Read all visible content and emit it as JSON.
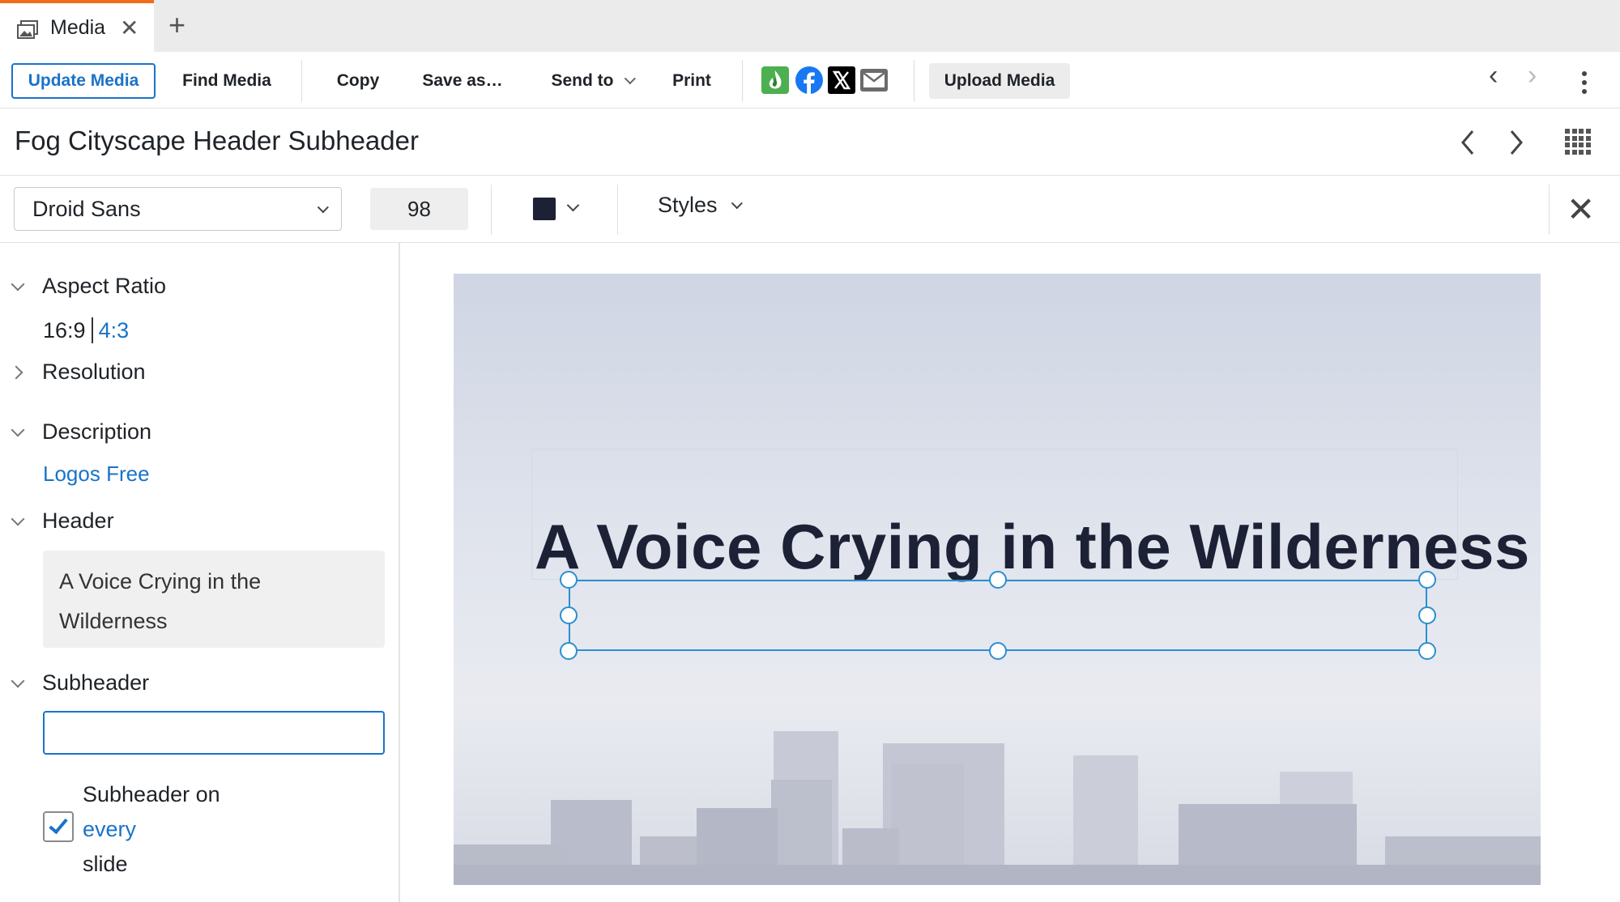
{
  "tab": {
    "label": "Media",
    "icon": "media-gallery-icon",
    "accent": "#f26b1d"
  },
  "toolbar": {
    "update_media": "Update Media",
    "find_media": "Find Media",
    "copy": "Copy",
    "save_as": "Save as…",
    "send_to": "Send to",
    "print": "Print",
    "upload_media": "Upload Media",
    "share_icons": [
      "logos-flame-icon",
      "facebook-icon",
      "x-twitter-icon",
      "email-icon"
    ]
  },
  "title": "Fog Cityscape Header Subheader",
  "format": {
    "font": "Droid Sans",
    "size": "98",
    "text_color": "#1c2136",
    "styles": "Styles"
  },
  "panel": {
    "aspect_ratio": {
      "label": "Aspect Ratio",
      "active": "16:9",
      "option": "4:3"
    },
    "resolution": {
      "label": "Resolution"
    },
    "description": {
      "label": "Description",
      "link": "Logos Free"
    },
    "header": {
      "label": "Header",
      "value": "A Voice Crying in the Wilderness"
    },
    "subheader": {
      "label": "Subheader",
      "value": "",
      "every_slide_text_1": "Subheader on",
      "every_slide_text_2": "every",
      "every_slide_text_3": "slide",
      "every_slide_checked": true
    }
  },
  "slide": {
    "title": "A Voice Crying in the Wilderness",
    "subtitle": ""
  },
  "colors": {
    "accent_blue": "#1a73c8",
    "selection": "#2b8fd1",
    "tab_accent": "#f26b1d"
  }
}
